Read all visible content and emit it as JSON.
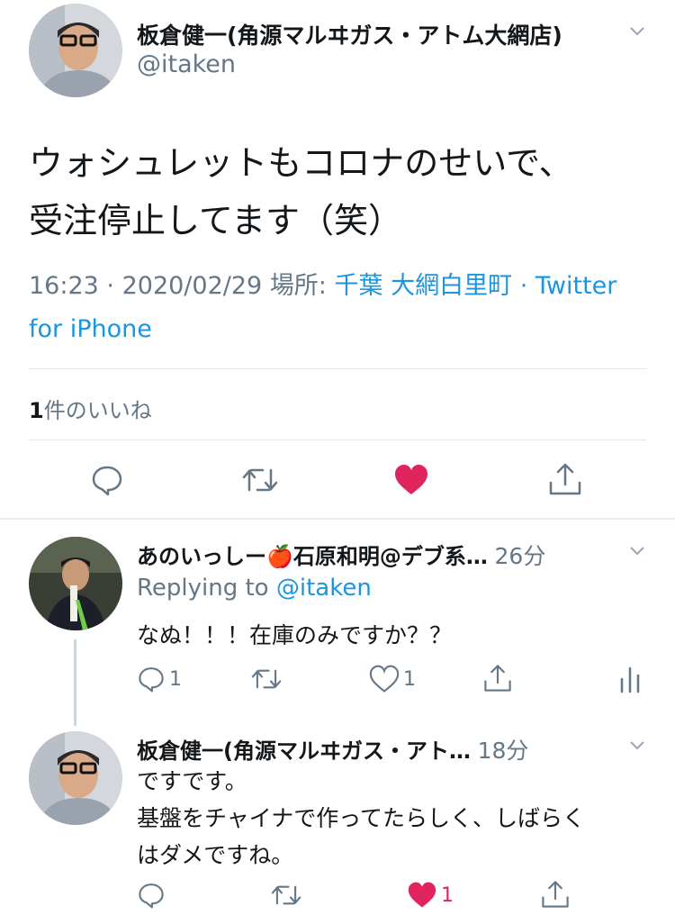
{
  "main_tweet": {
    "display_name": "板倉健一(角源マルヰガス・アトム大網店)",
    "handle": "@itaken",
    "text_line1": "ウォシュレットもコロナのせいで、",
    "text_line2": "受注停止してます（笑）",
    "time": "16:23",
    "sep1": "·",
    "date": "2020/02/29",
    "location_label": "場所:",
    "location": "千葉 大網白里町",
    "sep2": "·",
    "source_part1": "Twitter",
    "source_part2": "for iPhone",
    "likes_count": "1",
    "likes_label": "件のいいね"
  },
  "replies": [
    {
      "display_name": "あのいっしー🍎石原和明@デブ系…",
      "time_ago": "26分",
      "replying_label": "Replying to",
      "replying_handle": "@itaken",
      "text_lines": [
        "なぬ！！！在庫のみですか？？"
      ],
      "reply_count": "1",
      "retweet_count": "",
      "like_count": "1",
      "liked": false
    },
    {
      "display_name": "板倉健一(角源マルヰガス・アト…",
      "time_ago": "18分",
      "text_lines": [
        "ですです。",
        "基盤をチャイナで作ってたらしく、しばらく",
        "はダメですね。"
      ],
      "reply_count": "",
      "retweet_count": "",
      "like_count": "1",
      "liked": true
    }
  ],
  "colors": {
    "like_red": "#e0245e",
    "link_blue": "#1b95e0",
    "gray": "#657786"
  },
  "icons": {
    "reply": "reply-icon",
    "retweet": "retweet-icon",
    "like": "heart-icon",
    "share": "share-icon",
    "analytics": "analytics-icon",
    "more": "chevron-down-icon"
  }
}
